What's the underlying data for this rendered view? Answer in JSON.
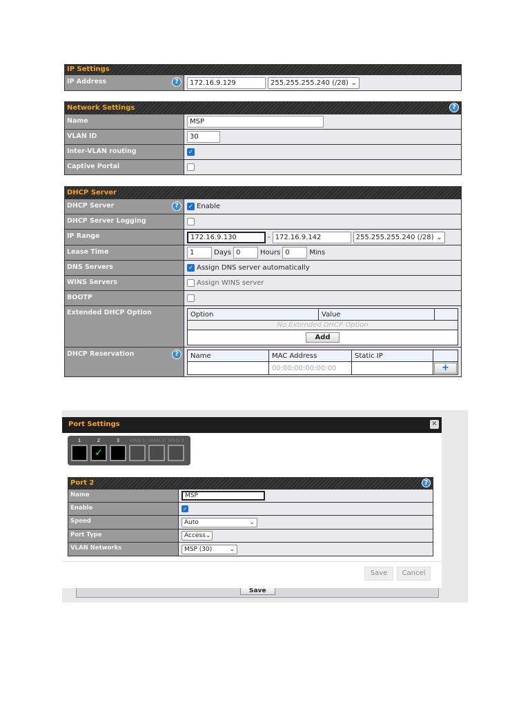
{
  "ip_settings": {
    "title": "IP Settings",
    "ip_label": "IP Address",
    "ip_value": "172.16.9.129",
    "mask": "255.255.255.240 (/28)"
  },
  "network_settings": {
    "title": "Network Settings",
    "name_label": "Name",
    "name_value": "MSP",
    "vlan_label": "VLAN ID",
    "vlan_value": "30",
    "intervlan_label": "Inter-VLAN routing",
    "intervlan_checked": true,
    "captive_label": "Captive Portal",
    "captive_checked": false
  },
  "dhcp": {
    "title": "DHCP Server",
    "server_label": "DHCP Server",
    "enable_label": "Enable",
    "logging_label": "DHCP Server Logging",
    "range_label": "IP Range",
    "range_start": "172.16.9.130",
    "range_sep": "-",
    "range_end": "172.16.9.142",
    "range_mask": "255.255.255.240 (/28)",
    "lease_label": "Lease Time",
    "lease_days": "1",
    "days_label": "Days",
    "lease_hours": "0",
    "hours_label": "Hours",
    "lease_mins": "0",
    "mins_label": "Mins",
    "dns_label": "DNS Servers",
    "dns_auto_label": "Assign DNS server automatically",
    "wins_label": "WINS Servers",
    "wins_assign_label": "Assign WINS server",
    "bootp_label": "BOOTP",
    "ext_label": "Extended DHCP Option",
    "ext_col_option": "Option",
    "ext_col_value": "Value",
    "ext_empty": "No Extended DHCP Option",
    "add_label": "Add",
    "res_label": "DHCP Reservation",
    "res_col_name": "Name",
    "res_col_mac": "MAC Address",
    "res_col_ip": "Static IP",
    "mac_placeholder": "00:00:00:00:00:00",
    "plus": "+"
  },
  "port_dialog": {
    "title": "Port Settings",
    "close": "×",
    "ports": [
      "1",
      "2",
      "3",
      "WAN 1",
      "WAN 2",
      "WAN 3"
    ],
    "port_title": "Port 2",
    "name_label": "Name",
    "name_value": "MSP",
    "enable_label": "Enable",
    "speed_label": "Speed",
    "speed_value": "Auto",
    "type_label": "Port Type",
    "type_value": "Access",
    "vlan_label": "VLAN Networks",
    "vlan_value": "MSP (30)",
    "save": "Save",
    "cancel": "Cancel",
    "bg_save": "Save"
  }
}
